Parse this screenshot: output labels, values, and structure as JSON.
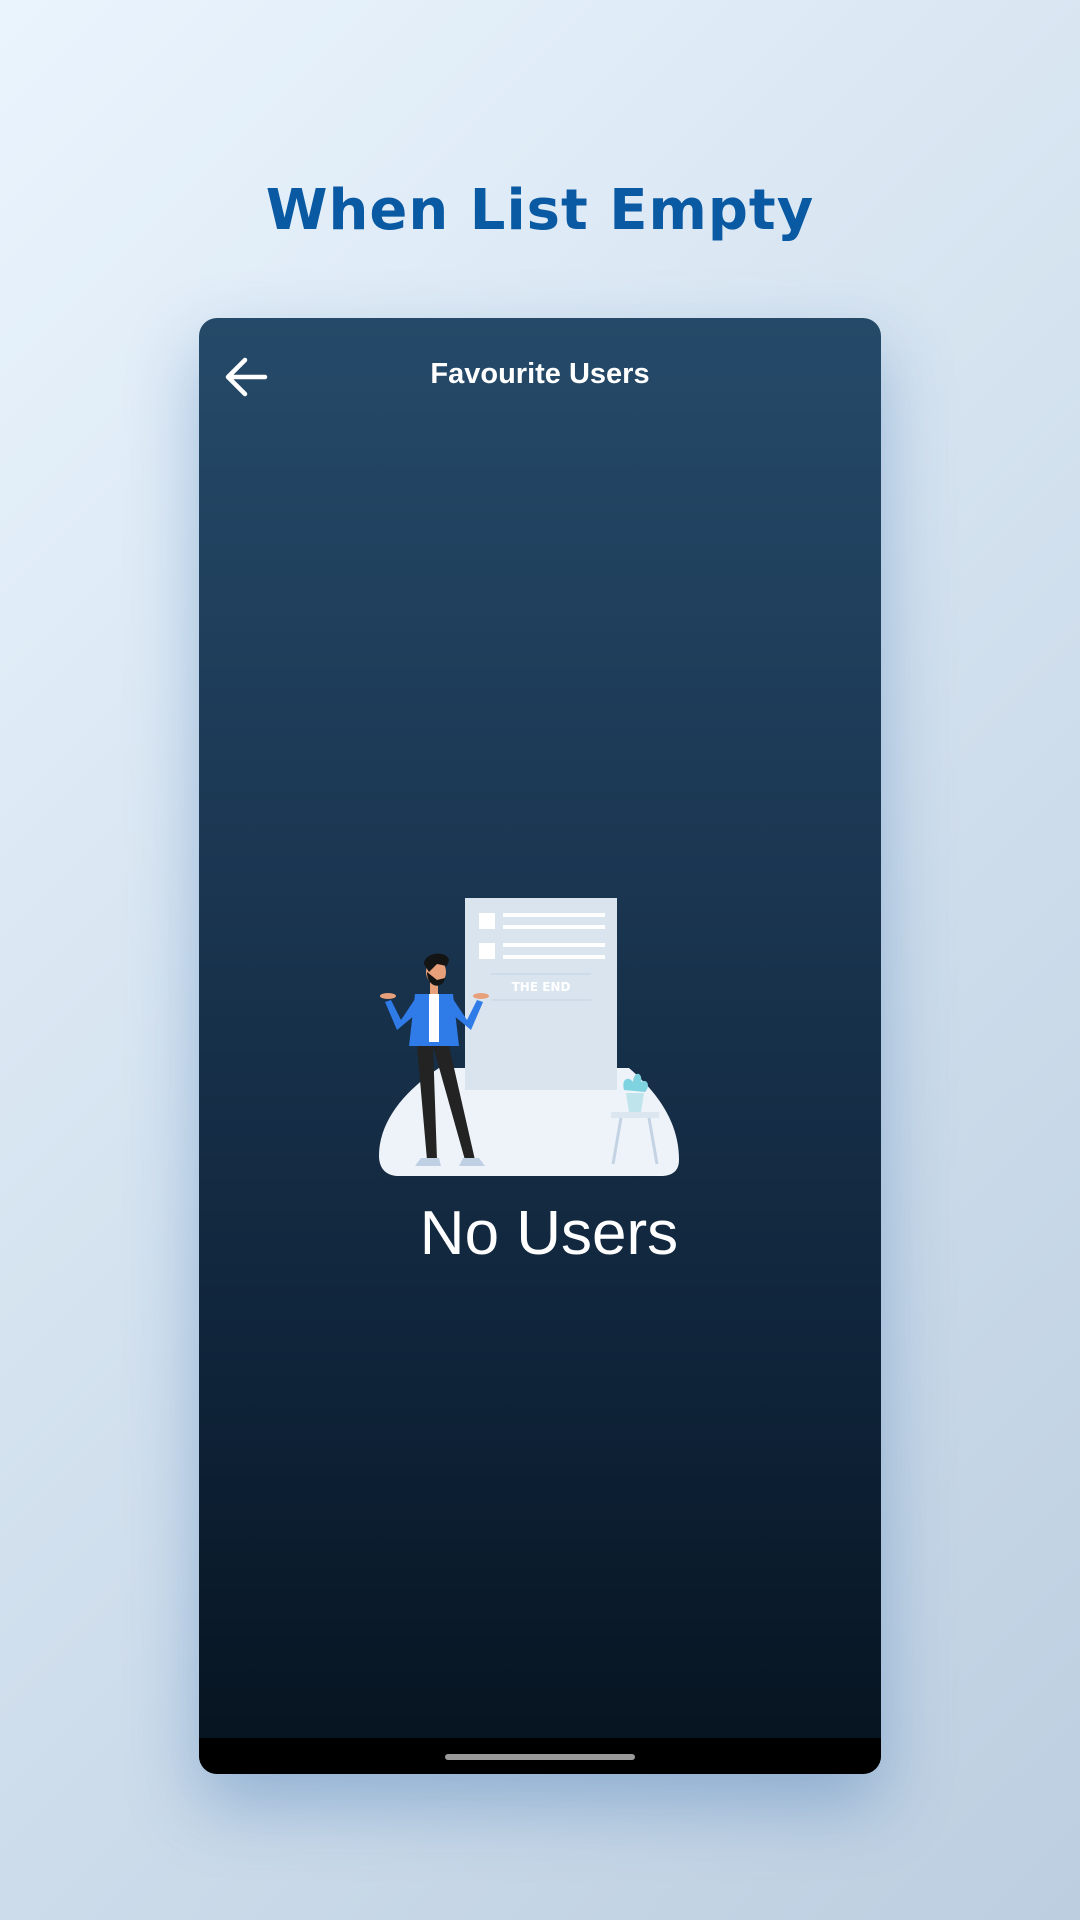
{
  "heading": "When List Empty",
  "app": {
    "title": "Favourite Users",
    "back_icon": "arrow-left-icon"
  },
  "empty_state": {
    "illustration_text": "THE END",
    "message": "No Users"
  },
  "colors": {
    "heading": "#0a5aa3",
    "screen_top": "#254a69",
    "screen_bottom": "#06131f",
    "jacket": "#2f7be8",
    "plant": "#7fd3e0"
  }
}
